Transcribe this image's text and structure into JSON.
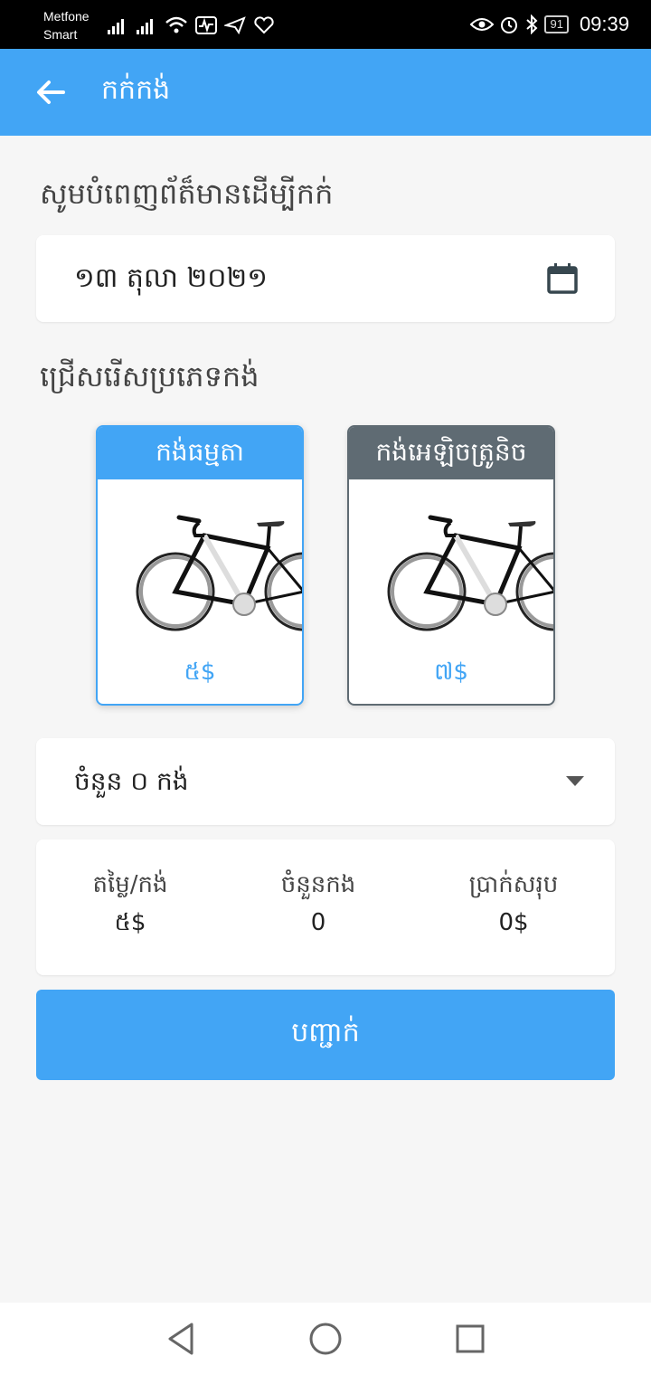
{
  "status_bar": {
    "carrier_line1": "Metfone",
    "carrier_line2": "Smart",
    "battery": "91",
    "time": "09:39"
  },
  "app_bar": {
    "title": "កក់កង់"
  },
  "form": {
    "fill_info_label": "សូមបំពេញព័ត៏មានដើម្បីកក់",
    "date_value": "១៣ តុលា ២០២១",
    "choose_type_label": "ជ្រើសរើសប្រភេទកង់",
    "bike_types": [
      {
        "name": "កង់ធម្មតា",
        "price": "៥$",
        "selected": true
      },
      {
        "name": "កង់អេឡិចត្រូនិច",
        "price": "៧$",
        "selected": false
      }
    ],
    "quantity_select": "ចំនួន ០ កង់"
  },
  "summary": {
    "price_per_bike_label": "តម្លៃ/កង់",
    "price_per_bike_value": "៥$",
    "bike_count_label": "ចំនួនកង",
    "bike_count_value": "0",
    "total_label": "ប្រាក់សរុប",
    "total_value": "0$"
  },
  "confirm_button": "បញ្ជាក់",
  "colors": {
    "primary": "#42a5f5",
    "unselected_card": "#5f6b73",
    "background": "#f6f6f6"
  }
}
